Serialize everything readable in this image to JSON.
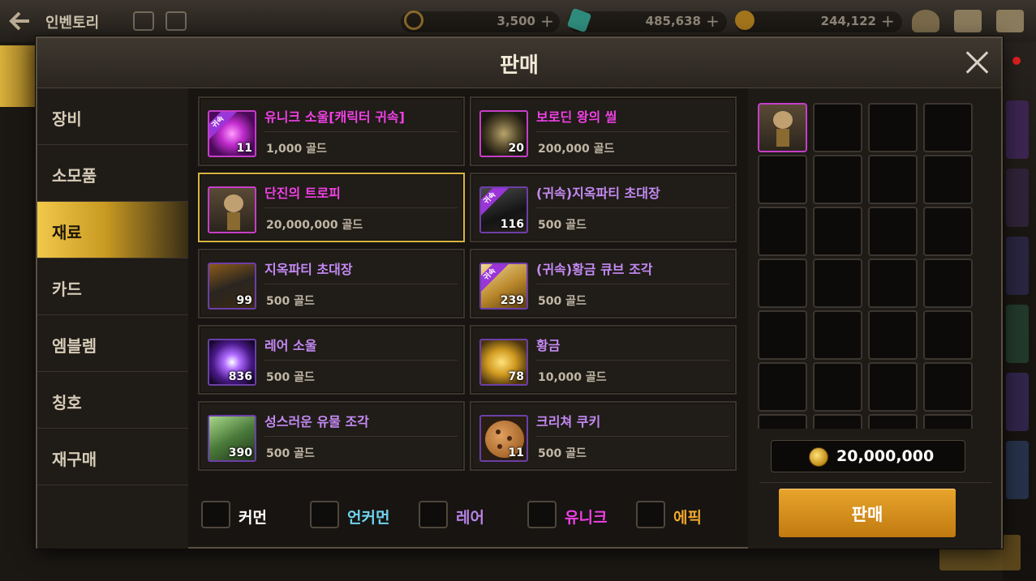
{
  "topbar": {
    "title": "인벤토리",
    "currency1": "3,500",
    "currency2": "485,638",
    "currency3": "244,122"
  },
  "dialog": {
    "title": "판매"
  },
  "sidebar": {
    "items": [
      {
        "label": "장비"
      },
      {
        "label": "소모품"
      },
      {
        "label": "재료"
      },
      {
        "label": "카드"
      },
      {
        "label": "엠블렘"
      },
      {
        "label": "칭호"
      },
      {
        "label": "재구매"
      }
    ],
    "active_index": 2
  },
  "items": [
    {
      "name": "유니크 소울[캐릭터 귀속]",
      "price": "1,000 골드",
      "qty": "11",
      "rarity": "unique",
      "badge": "귀속",
      "icon": "unique-soul-icon",
      "selected": false
    },
    {
      "name": "보로딘 왕의 씰",
      "price": "200,000 골드",
      "qty": "20",
      "rarity": "unique",
      "icon": "king-seal-icon",
      "selected": false
    },
    {
      "name": "단진의 트로피",
      "price": "20,000,000 골드",
      "qty": "",
      "rarity": "unique",
      "icon": "trophy-icon",
      "selected": true
    },
    {
      "name": "(귀속)지옥파티 초대장",
      "price": "500 골드",
      "qty": "116",
      "rarity": "rare",
      "badge": "귀속",
      "icon": "hell-invitation-icon",
      "selected": false
    },
    {
      "name": "지옥파티 초대장",
      "price": "500 골드",
      "qty": "99",
      "rarity": "rare",
      "icon": "hell-invitation-icon",
      "selected": false
    },
    {
      "name": "(귀속)황금 큐브 조각",
      "price": "500 골드",
      "qty": "239",
      "rarity": "rare",
      "badge": "귀속",
      "icon": "gold-cube-icon",
      "selected": false
    },
    {
      "name": "레어 소울",
      "price": "500 골드",
      "qty": "836",
      "rarity": "rare",
      "icon": "rare-soul-icon",
      "selected": false
    },
    {
      "name": "황금",
      "price": "10,000 골드",
      "qty": "78",
      "rarity": "rare",
      "icon": "gold-nugget-icon",
      "selected": false
    },
    {
      "name": "성스러운 유물 조각",
      "price": "500 골드",
      "qty": "390",
      "rarity": "rare",
      "icon": "holy-relic-icon",
      "selected": false
    },
    {
      "name": "크리쳐 쿠키",
      "price": "500 골드",
      "qty": "11",
      "rarity": "rare",
      "icon": "cookie-icon",
      "selected": false
    }
  ],
  "filters": [
    {
      "label": "커먼",
      "color": "#ffffff"
    },
    {
      "label": "언커먼",
      "color": "#6fd3f0"
    },
    {
      "label": "레어",
      "color": "#b884e8"
    },
    {
      "label": "유니크",
      "color": "#f040e6"
    },
    {
      "label": "에픽",
      "color": "#f0a82c"
    }
  ],
  "sell": {
    "total": "20,000,000",
    "button_label": "판매"
  },
  "colors": {
    "accent": "#d8b441",
    "sell_button": "#d8951e",
    "unique": "#f040e6",
    "rare": "#c48af5"
  }
}
